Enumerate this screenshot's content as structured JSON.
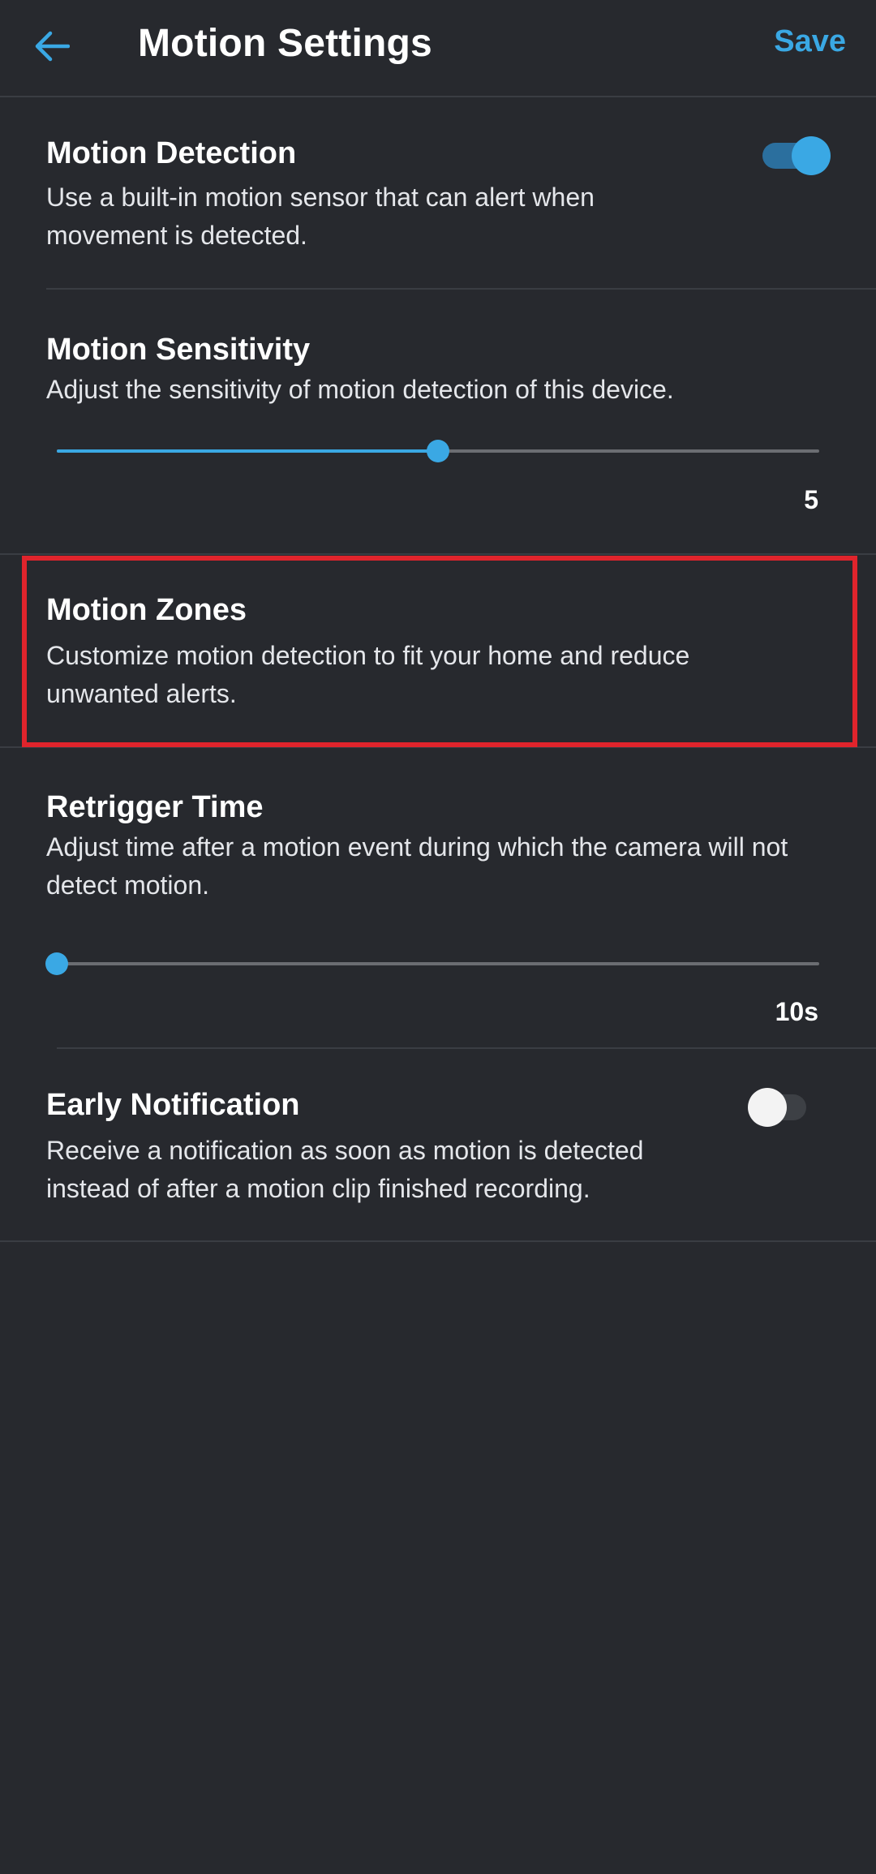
{
  "header": {
    "back_icon": "arrow-left-icon",
    "title": "Motion Settings",
    "save_label": "Save"
  },
  "colors": {
    "background": "#27292e",
    "accent": "#3aa8e4",
    "highlight": "#e0242c",
    "divider": "#3a3d43"
  },
  "motion_detection": {
    "title": "Motion Detection",
    "description": "Use a built-in motion sensor that can alert when movement is detected.",
    "enabled": true
  },
  "motion_sensitivity": {
    "title": "Motion Sensitivity",
    "description": "Adjust the sensitivity of motion detection of this device.",
    "value": 5,
    "value_label": "5",
    "level": 0.5
  },
  "motion_zones": {
    "title": "Motion Zones",
    "description": "Customize motion detection to fit your home and reduce unwanted alerts."
  },
  "retrigger_time": {
    "title": "Retrigger Time",
    "description": "Adjust time after a motion event during which the camera will not detect motion.",
    "value_label": "10s",
    "level": 0
  },
  "early_notification": {
    "title": "Early Notification",
    "description": "Receive a notification as soon as motion is detected instead of after a motion clip finished recording.",
    "enabled": false
  }
}
